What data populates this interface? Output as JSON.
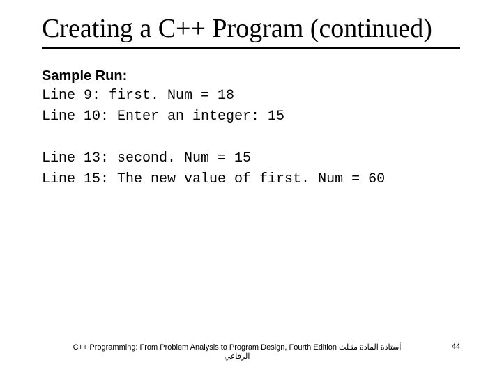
{
  "title": "Creating a C++ Program (continued)",
  "label": "Sample Run:",
  "block1": "Line 9: first. Num = 18\nLine 10: Enter an integer: 15",
  "block2": "Line 13: second. Num = 15\nLine 15: The new value of first. Num = 60",
  "footer_left_line1": "C++ Programming: From Problem Analysis to Program Design, Fourth Edition أستاذة المادة مثـلث",
  "footer_left_line2": "الرفاعي",
  "page_number": "44"
}
